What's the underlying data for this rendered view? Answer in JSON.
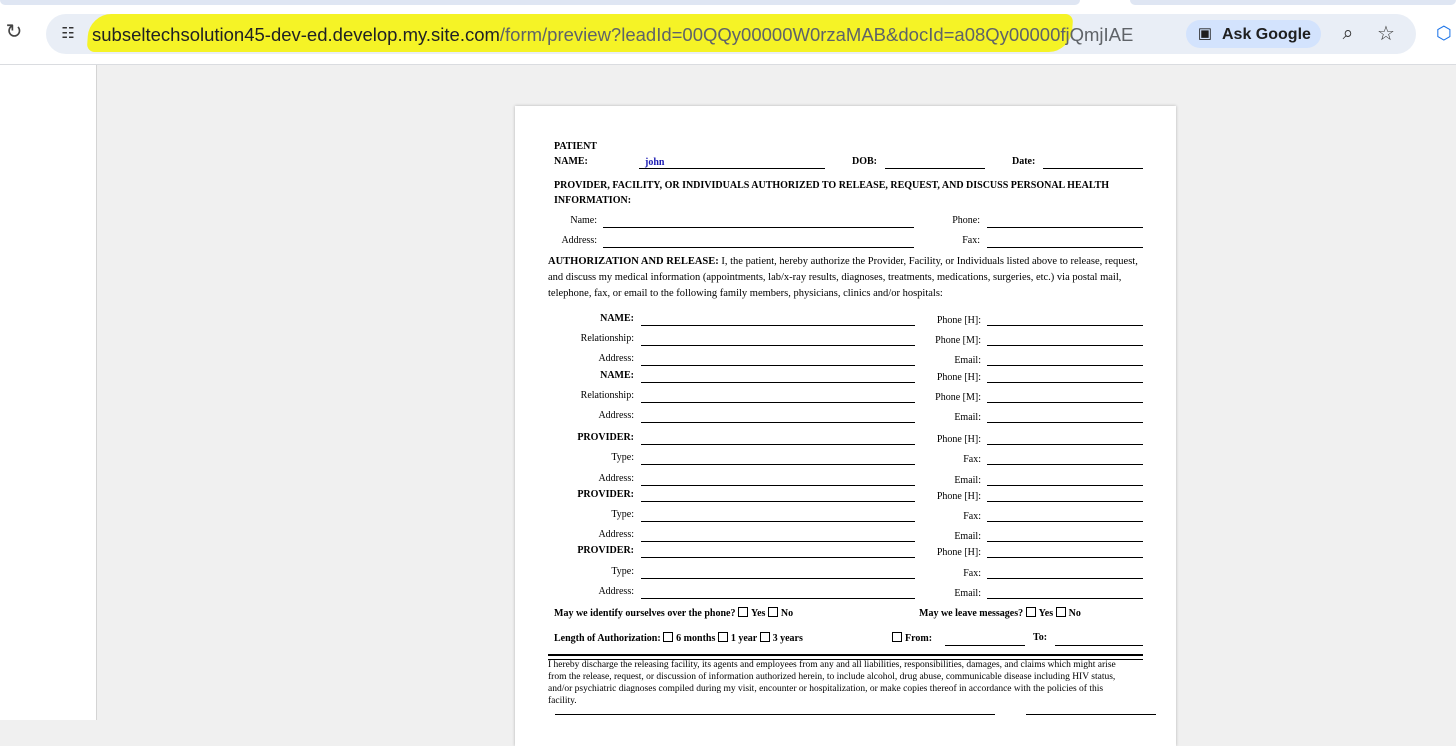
{
  "browser": {
    "url_host": "subseltechsolution45-dev-ed.develop.my.site.com",
    "url_path": "/form/preview?leadId=00QQy00000W0rzaMAB&docId=a08Qy00000fjQmjIAE",
    "ask_google_label": "Ask Google",
    "icons": [
      "reload-icon",
      "site-info-icon",
      "google-lens-icon",
      "zoom-icon",
      "star-icon",
      "extension-icon"
    ]
  },
  "form": {
    "patient_label_1": "PATIENT",
    "patient_label_2": "NAME:",
    "patient_name_value": "john",
    "dob_label": "DOB:",
    "date_label": "Date:",
    "provider_heading": "PROVIDER, FACILITY, OR INDIVIDUALS AUTHORIZED TO RELEASE, REQUEST, AND DISCUSS PERSONAL HEALTH INFORMATION:",
    "name_label": "Name:",
    "phone_label": "Phone:",
    "address_label": "Address:",
    "fax_label": "Fax:",
    "auth_heading": "AUTHORIZATION AND RELEASE:",
    "auth_text": " I, the patient, hereby authorize the Provider, Facility, or Individuals listed above to release, request, and discuss my medical information (appointments, lab/x-ray results, diagnoses, treatments, medications, surgeries, etc.) via postal mail, telephone, fax, or email to the following family members, physicians, clinics and/or hospitals:",
    "rows": [
      {
        "left": "NAME:",
        "left_bold": true,
        "right": "Phone [H]:"
      },
      {
        "left": "Relationship:",
        "left_bold": false,
        "right": "Phone [M]:"
      },
      {
        "left": "Address:",
        "left_bold": false,
        "right": "Email:"
      },
      {
        "left": "NAME:",
        "left_bold": true,
        "right": "Phone [H]:"
      },
      {
        "left": "Relationship:",
        "left_bold": false,
        "right": "Phone [M]:"
      },
      {
        "left": "Address:",
        "left_bold": false,
        "right": "Email:"
      },
      {
        "left": "PROVIDER:",
        "left_bold": true,
        "right": "Phone [H]:"
      },
      {
        "left": "Type:",
        "left_bold": false,
        "right": "Fax:"
      },
      {
        "left": "Address:",
        "left_bold": false,
        "right": "Email:"
      },
      {
        "left": "PROVIDER:",
        "left_bold": true,
        "right": "Phone [H]:"
      },
      {
        "left": "Type:",
        "left_bold": false,
        "right": "Fax:"
      },
      {
        "left": "Address:",
        "left_bold": false,
        "right": "Email:"
      },
      {
        "left": "PROVIDER:",
        "left_bold": true,
        "right": "Phone [H]:"
      },
      {
        "left": "Type:",
        "left_bold": false,
        "right": "Fax:"
      },
      {
        "left": "Address:",
        "left_bold": false,
        "right": "Email:"
      }
    ],
    "identify_question": "May we identify ourselves over the phone?",
    "messages_question": "May we leave messages?",
    "yes": "Yes",
    "no": "No",
    "length_label": "Length of Authorization:",
    "opt_6": "6 months",
    "opt_1": "1 year",
    "opt_3": "3 years",
    "from_label": "From:",
    "to_label": "To:",
    "discharge_text": "I hereby discharge the releasing facility, its agents and employees from any and all liabilities, responsibilities, damages, and claims which might arise from the release, request, or discussion of information authorized herein, to include alcohol, drug abuse, communicable disease including HIV status, and/or psychiatric diagnoses compiled during my visit, encounter or hospitalization, or make copies thereof in accordance with the policies of this facility."
  }
}
